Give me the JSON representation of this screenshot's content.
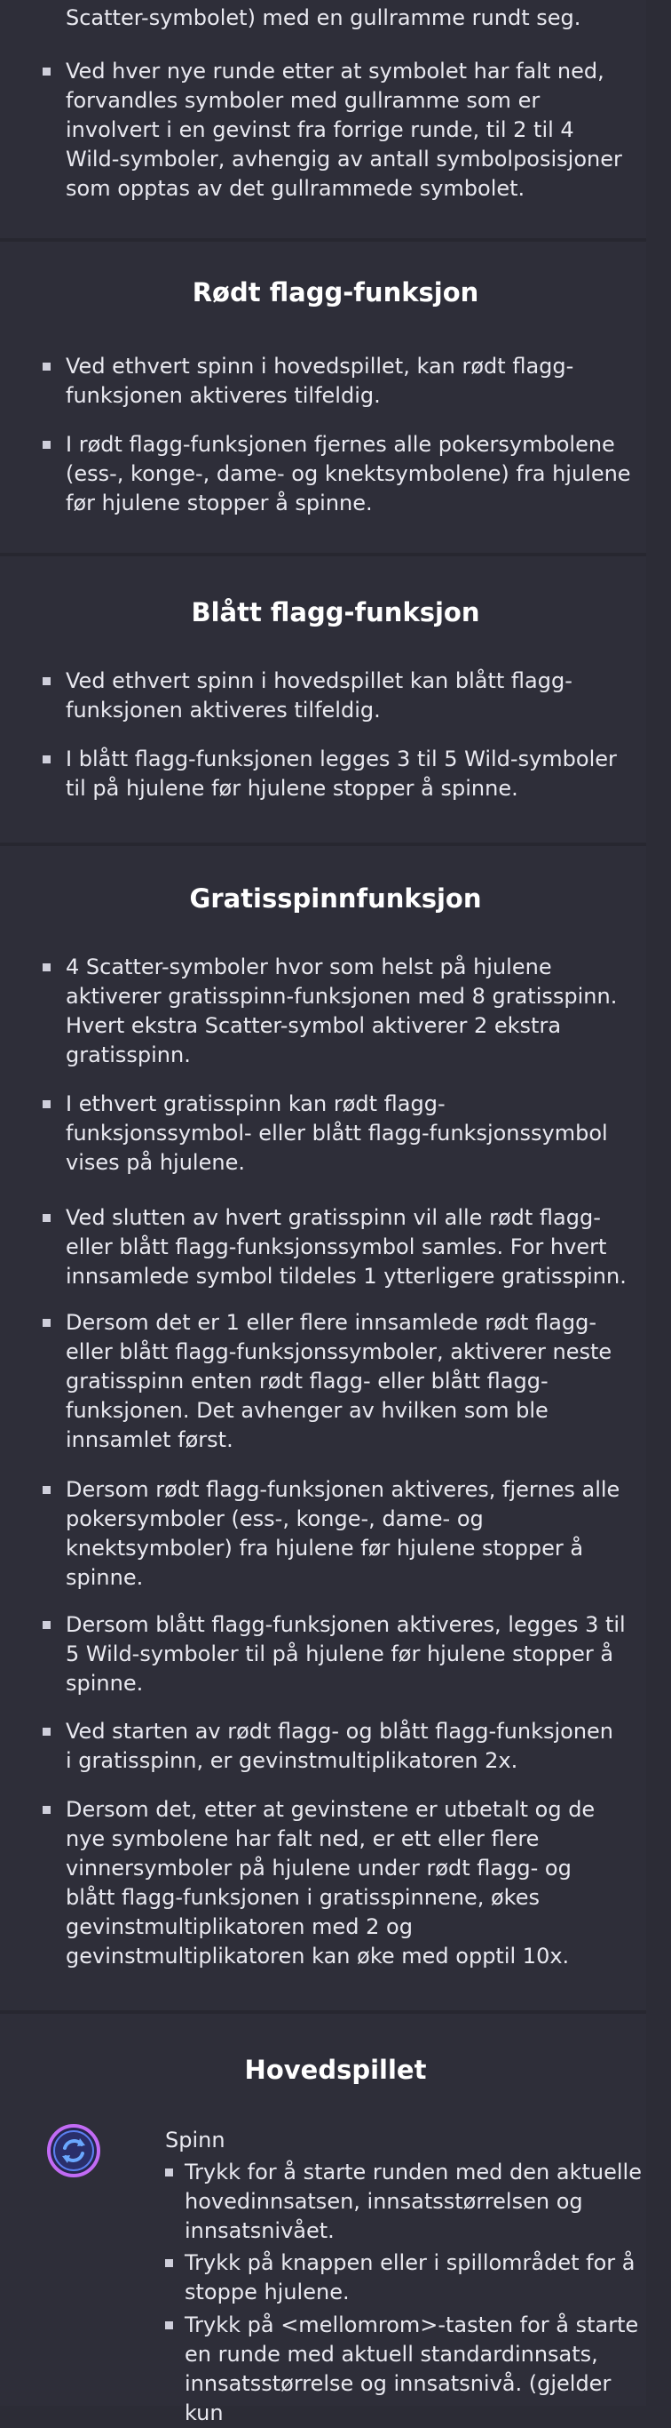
{
  "intro": {
    "partial_line": "Scatter-symbolet) med en gullramme rundt seg.",
    "bullet": "Ved hver nye runde etter at symbolet har falt ned,\nforvandles symboler med gullramme som er\ninvolvert i en gevinst fra forrige runde, til 2 til 4\nWild-symboler, avhengig av antall symbolposisjoner\nsom opptas av det gullrammede symbolet."
  },
  "red_flag": {
    "title": "Rødt flagg-funksjon",
    "bullets": [
      "Ved ethvert spinn i hovedspillet, kan rødt flagg-\nfunksjonen aktiveres tilfeldig.",
      "I rødt flagg-funksjonen fjernes alle pokersymbolene\n(ess-, konge-, dame- og knektsymbolene) fra hjulene\nfør hjulene stopper å spinne."
    ]
  },
  "blue_flag": {
    "title": "Blått flagg-funksjon",
    "bullets": [
      "Ved ethvert spinn i hovedspillet kan blått flagg-\nfunksjonen aktiveres tilfeldig.",
      "I blått flagg-funksjonen legges 3 til 5 Wild-symboler\ntil på hjulene før hjulene stopper å spinne."
    ]
  },
  "free_spins": {
    "title": "Gratisspinnfunksjon",
    "bullets": [
      "4 Scatter-symboler hvor som helst på hjulene\naktiverer gratisspinn-funksjonen med 8 gratisspinn.\nHvert ekstra Scatter-symbol aktiverer 2 ekstra\ngratisspinn.",
      "I ethvert gratisspinn kan rødt flagg-\nfunksjonssymbol- eller blått flagg-funksjonssymbol\nvises på hjulene.",
      "Ved slutten av hvert gratisspinn vil alle rødt flagg-\neller blått flagg-funksjonssymbol samles. For hvert\ninnsamlede symbol tildeles 1 ytterligere gratisspinn.",
      "Dersom det er 1 eller flere innsamlede rødt flagg-\neller blått flagg-funksjonssymboler, aktiverer neste\ngratisspinn enten rødt flagg- eller blått flagg-\nfunksjonen. Det avhenger av hvilken som ble\ninnsamlet først.",
      "Dersom rødt flagg-funksjonen aktiveres, fjernes alle\npokersymboler (ess-, konge-, dame- og\nknektsymboler) fra hjulene før hjulene stopper å\nspinne.",
      "Dersom blått flagg-funksjonen aktiveres, legges 3 til\n5 Wild-symboler til på hjulene før hjulene stopper å\nspinne.",
      "Ved starten av rødt flagg- og blått flagg-funksjonen\ni gratisspinn, er gevinstmultiplikatoren 2x.",
      "Dersom det, etter at gevinstene er utbetalt og de\nnye symbolene har falt ned, er ett eller flere\nvinnersymboler på hjulene under rødt flagg- og\nblått flagg-funksjonen i gratisspinnene, økes\ngevinstmultiplikatoren med 2 og\ngevinstmultiplikatoren kan øke med opptil 10x."
    ]
  },
  "main_game": {
    "title": "Hovedspillet",
    "spin_label": "Spinn",
    "spin_icon": "spin-refresh-icon",
    "bullets": [
      "Trykk for å starte runden med den aktuelle\nhovedinnsatsen, innsatsstørrelsen og\ninnsatsnivået.",
      "Trykk på knappen eller i spillområdet for å\nstoppe hjulene.",
      "Trykk på <mellomrom>-tasten for å starte\nen runde med aktuell standardinnsats,\ninnsatsstørrelse og innsatsnivå. (gjelder kun"
    ]
  },
  "colors": {
    "background": "#2c2c36",
    "text": "#e9e9f0",
    "title": "#ffffff",
    "icon_ring": "#c26bf5",
    "icon_inner": "#3b6fe0"
  }
}
